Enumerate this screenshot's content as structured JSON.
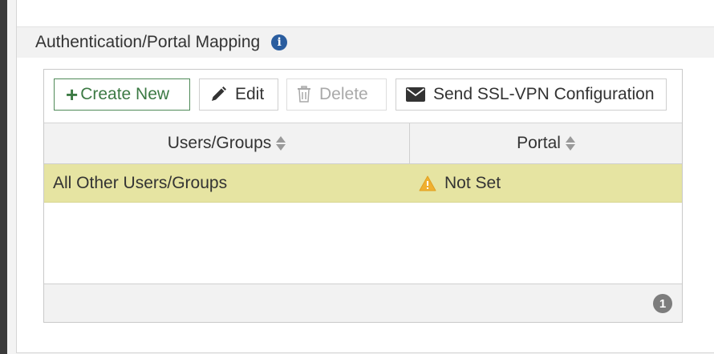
{
  "section": {
    "title": "Authentication/Portal Mapping",
    "info_icon": "info-icon"
  },
  "toolbar": {
    "create_label": "Create New",
    "edit_label": "Edit",
    "delete_label": "Delete",
    "send_label": "Send SSL-VPN Configuration"
  },
  "table": {
    "columns": [
      "Users/Groups",
      "Portal"
    ],
    "rows": [
      {
        "users": "All Other Users/Groups",
        "portal": "Not Set",
        "portal_icon": "warning-icon"
      }
    ],
    "count": "1"
  },
  "colors": {
    "selected_row": "#e6e4a2",
    "create_accent": "#3c7a44",
    "info_icon": "#2a5d9f",
    "warning_icon": "#f0b030",
    "badge": "#7d7d7d"
  }
}
